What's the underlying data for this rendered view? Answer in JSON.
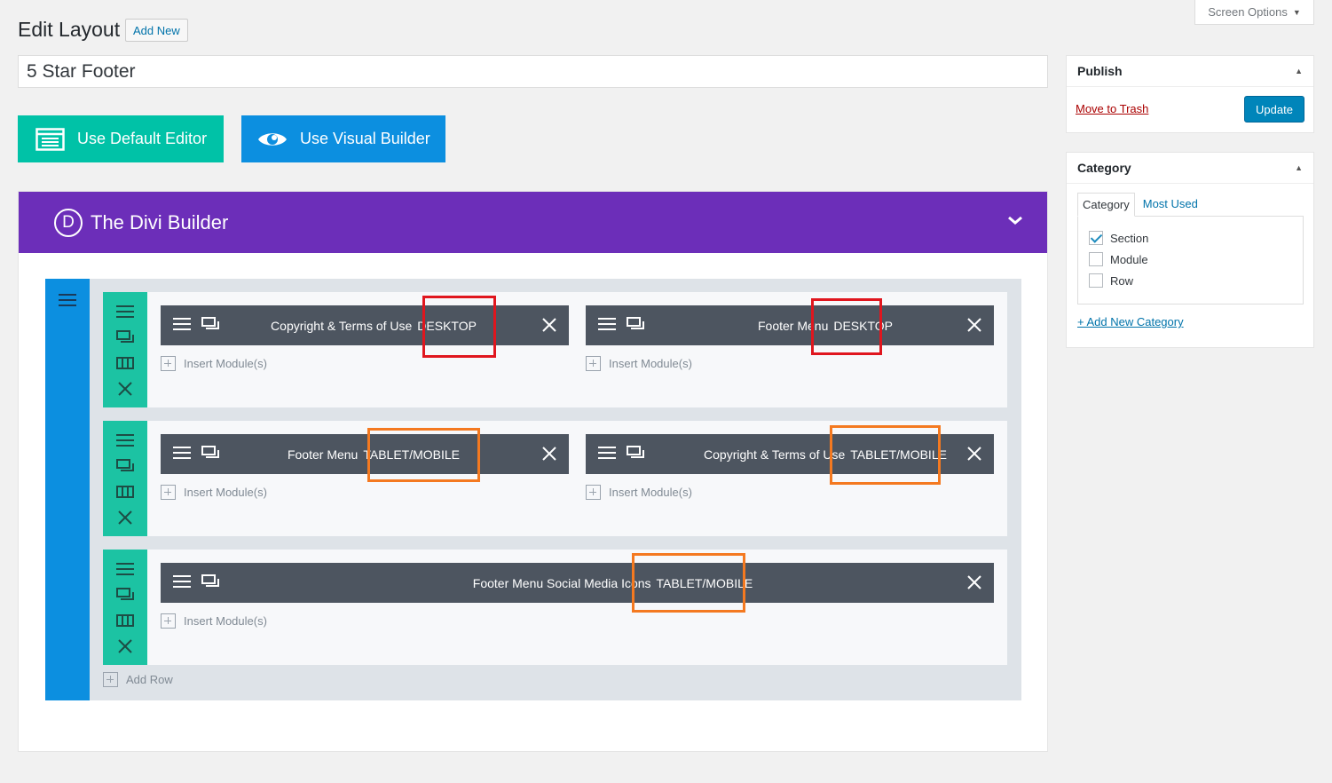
{
  "screen_options": {
    "label": "Screen Options"
  },
  "header": {
    "title": "Edit Layout",
    "add_new": "Add New"
  },
  "post_title": "5 Star Footer",
  "editor_buttons": {
    "default": "Use Default Editor",
    "visual": "Use Visual Builder"
  },
  "builder": {
    "title": "The Divi Builder",
    "logo_letter": "D",
    "colors": {
      "header": "#6c2eb9",
      "section": "#0c8fe0",
      "row": "#1cc3a3",
      "module": "#4d5560"
    },
    "rows": [
      {
        "modules": [
          {
            "name": "Copyright & Terms of Use",
            "tag": "DESKTOP",
            "highlight": "#e0161e"
          },
          {
            "name": "Footer Menu",
            "tag": "DESKTOP",
            "highlight": "#e0161e"
          }
        ]
      },
      {
        "modules": [
          {
            "name": "Footer Menu",
            "tag": "TABLET/MOBILE",
            "highlight": "#f47920"
          },
          {
            "name": "Copyright & Terms of Use",
            "tag": "TABLET/MOBILE",
            "highlight": "#f47920"
          }
        ]
      },
      {
        "modules": [
          {
            "name": "Footer Menu Social Media Icons",
            "tag": "TABLET/MOBILE",
            "highlight": "#f47920"
          }
        ]
      }
    ],
    "insert_label": "Insert Module(s)",
    "add_row_label": "Add Row"
  },
  "publish": {
    "title": "Publish",
    "trash": "Move to Trash",
    "update": "Update"
  },
  "category": {
    "title": "Category",
    "tabs": [
      "Category",
      "Most Used"
    ],
    "items": [
      {
        "label": "Section",
        "checked": true
      },
      {
        "label": "Module",
        "checked": false
      },
      {
        "label": "Row",
        "checked": false
      }
    ],
    "add_new": "+ Add New Category"
  }
}
